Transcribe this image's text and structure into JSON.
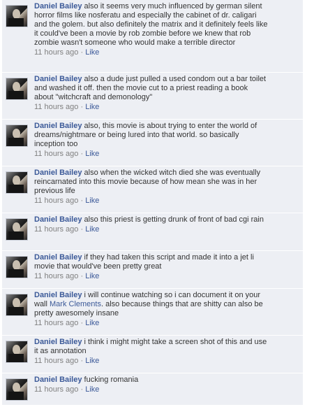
{
  "comments": [
    {
      "author": "Daniel Bailey",
      "text": "also it seems very much influenced by german silent horror films like nosferatu and especially the cabinet of dr. caligari and the golem. but also definitely the matrix and it definitely feels like it could've been a movie by rob zombie before we knew that rob zombie wasn't someone who would make a terrible director",
      "time": "11 hours ago",
      "like": "Like"
    },
    {
      "author": "Daniel Bailey",
      "text": "also a dude just pulled a used condom out a bar toilet and washed it off. then the movie cut to a priest reading a book about \"witchcraft and demonology\"",
      "time": "11 hours ago",
      "like": "Like"
    },
    {
      "author": "Daniel Bailey",
      "text": "also, this movie is about trying to enter the world of dreams/nightmare or being lured into that world. so basically inception too",
      "time": "11 hours ago",
      "like": "Like"
    },
    {
      "author": "Daniel Bailey",
      "text": "also when the wicked witch died she was eventually reincarnated into this movie because of how mean she was in her previous life",
      "time": "11 hours ago",
      "like": "Like"
    },
    {
      "author": "Daniel Bailey",
      "text": "also this priest is getting drunk of front of bad cgi rain",
      "time": "11 hours ago",
      "like": "Like"
    },
    {
      "author": "Daniel Bailey",
      "text": "if they had taken this script and made it into a jet li movie that would've been pretty great",
      "time": "11 hours ago",
      "like": "Like"
    },
    {
      "author": "Daniel Bailey",
      "text_before": "i will continue watching so i can document it on your wall ",
      "mention": "Mark Clements",
      "text_after": ". also because things that are shitty can also be pretty awesomely insane",
      "time": "11 hours ago",
      "like": "Like"
    },
    {
      "author": "Daniel Bailey",
      "text": "i think i might might take a screen shot of this and use it as annotation",
      "time": "11 hours ago",
      "like": "Like"
    },
    {
      "author": "Daniel Bailey",
      "text": "fucking romania",
      "time": "11 hours ago",
      "like": "Like"
    }
  ],
  "meta_separator": "·"
}
